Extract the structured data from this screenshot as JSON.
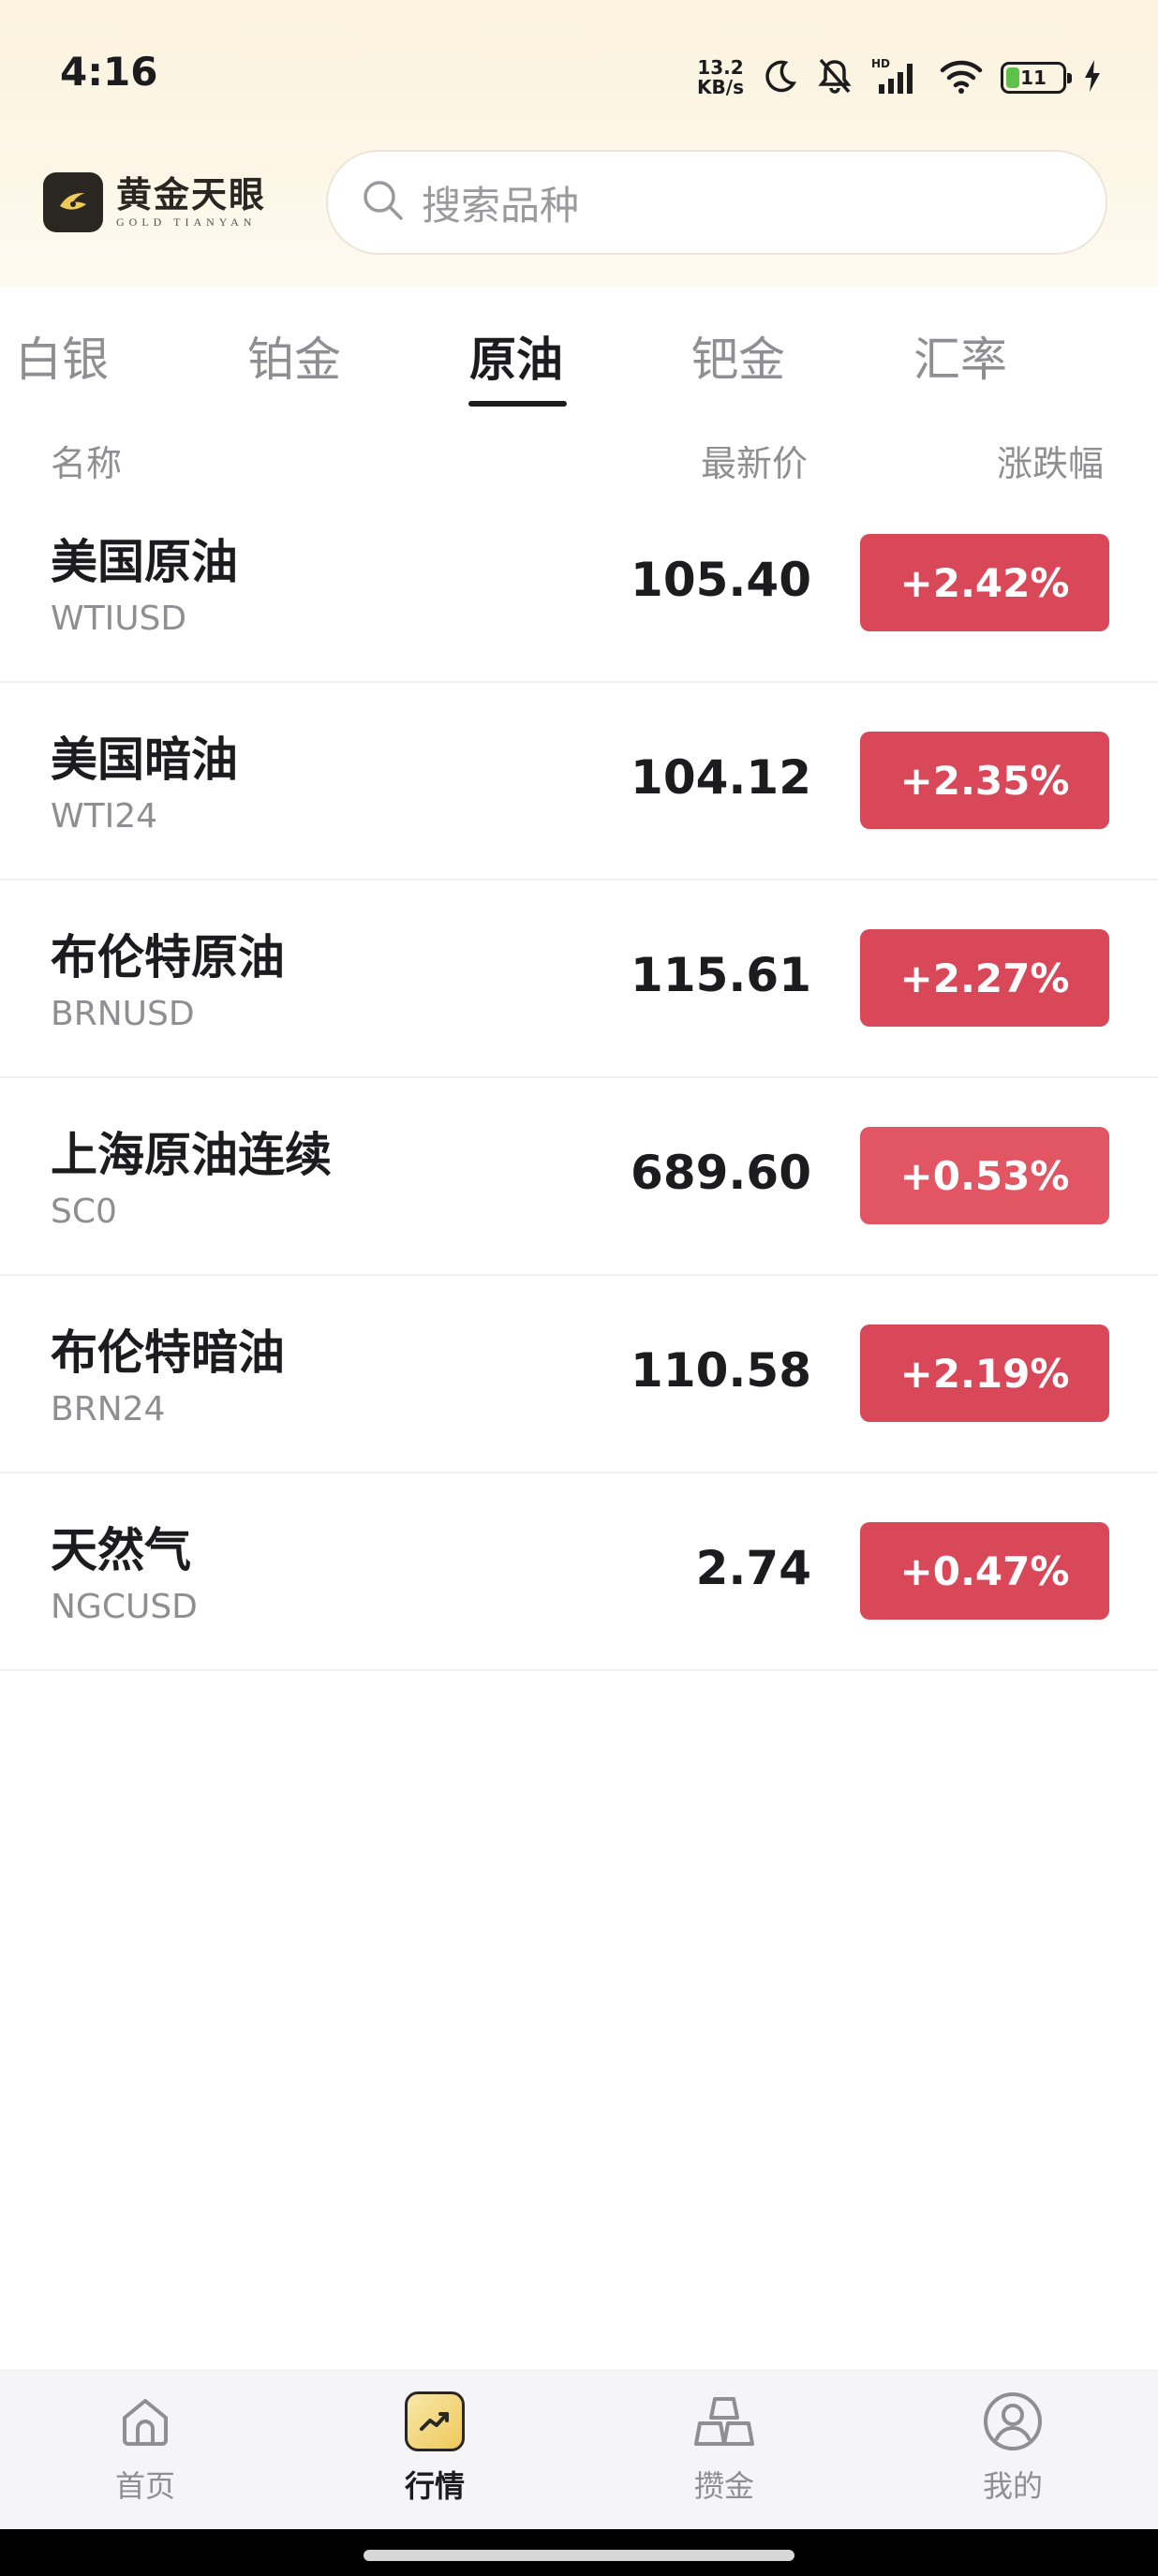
{
  "status_bar": {
    "time": "4:16",
    "net_speed_value": "13.2",
    "net_speed_unit": "KB/s",
    "battery_level": "11",
    "icons": [
      "moon-icon",
      "bell-muted-icon",
      "hd-signal-icon",
      "wifi-icon",
      "battery-icon",
      "charging-bolt-icon"
    ]
  },
  "brand": {
    "name": "黄金天眼",
    "subtitle": "GOLD TIANYAN"
  },
  "search": {
    "placeholder": "搜索品种"
  },
  "tabs": [
    {
      "label": "白银",
      "active": false
    },
    {
      "label": "铂金",
      "active": false
    },
    {
      "label": "原油",
      "active": true
    },
    {
      "label": "钯金",
      "active": false
    },
    {
      "label": "汇率",
      "active": false
    }
  ],
  "list_header": {
    "name": "名称",
    "price": "最新价",
    "change": "涨跌幅"
  },
  "rows": [
    {
      "name": "美国原油",
      "code": "WTIUSD",
      "price": "105.40",
      "change": "+2.42%",
      "color": "#d94858"
    },
    {
      "name": "美国暗油",
      "code": "WTI24",
      "price": "104.12",
      "change": "+2.35%",
      "color": "#d94858"
    },
    {
      "name": "布伦特原油",
      "code": "BRNUSD",
      "price": "115.61",
      "change": "+2.27%",
      "color": "#d94858"
    },
    {
      "name": "上海原油连续",
      "code": "SC0",
      "price": "689.60",
      "change": "+0.53%",
      "color": "#e25563"
    },
    {
      "name": "布伦特暗油",
      "code": "BRN24",
      "price": "110.58",
      "change": "+2.19%",
      "color": "#d94858"
    },
    {
      "name": "天然气",
      "code": "NGCUSD",
      "price": "2.74",
      "change": "+0.47%",
      "color": "#d94858"
    }
  ],
  "bottom_nav": [
    {
      "label": "首页",
      "icon": "home-icon",
      "active": false
    },
    {
      "label": "行情",
      "icon": "market-trend-icon",
      "active": true
    },
    {
      "label": "攒金",
      "icon": "gold-bars-icon",
      "active": false
    },
    {
      "label": "我的",
      "icon": "profile-icon",
      "active": false
    }
  ],
  "colors": {
    "accent_up": "#d94858",
    "gold": "#efc95a",
    "text_primary": "#1c1c1e",
    "text_secondary": "#8e8e93"
  }
}
